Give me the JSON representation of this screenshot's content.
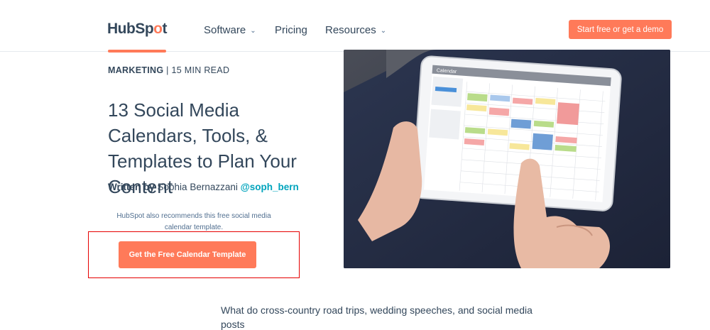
{
  "nav": {
    "logo": "HubSpot",
    "items": [
      {
        "label": "Software",
        "has_dropdown": true
      },
      {
        "label": "Pricing",
        "has_dropdown": false
      },
      {
        "label": "Resources",
        "has_dropdown": true
      }
    ],
    "cta_label": "Start free or get a demo"
  },
  "article": {
    "category": "MARKETING",
    "read_time": "15 MIN READ",
    "title": "13 Social Media Calendars, Tools, & Templates to Plan Your Content",
    "byline_prefix": "Written by",
    "author": "Sophia Bernazzani",
    "handle": "@soph_bern",
    "recommendation": "HubSpot also recommends this free social media calendar template.",
    "cta_label": "Get the Free Calendar Template",
    "hero_tablet_header": "Calendar",
    "intro_line1": "What do cross-country road trips, wedding speeches, and social media",
    "intro_line2": "posts"
  },
  "colors": {
    "accent": "#ff7a59",
    "text": "#33475b",
    "link": "#00a4bd",
    "highlight_border": "#e60000"
  }
}
